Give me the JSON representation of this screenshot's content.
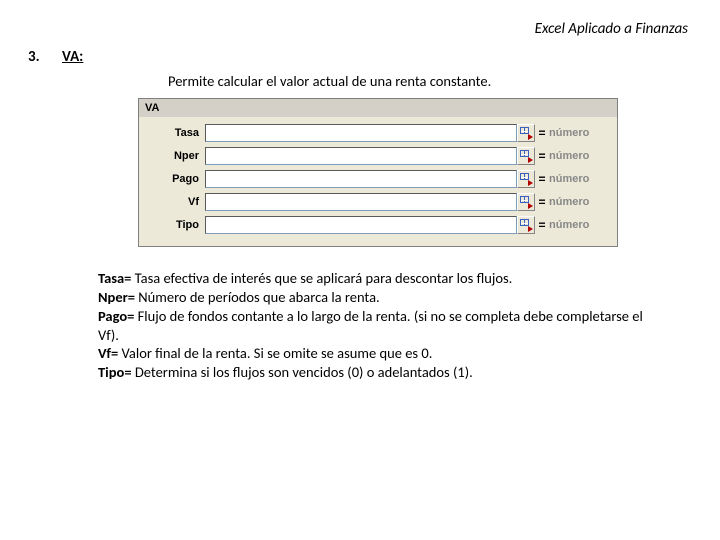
{
  "header": {
    "title": "Excel Aplicado a Finanzas"
  },
  "section": {
    "number": "3.",
    "function": "VA:",
    "description": "Permite calcular el valor actual de una renta constante."
  },
  "dialog": {
    "title": "VA",
    "eq": "=",
    "hint": "número",
    "fields": [
      {
        "label": "Tasa"
      },
      {
        "label": "Nper"
      },
      {
        "label": "Pago"
      },
      {
        "label": "Vf"
      },
      {
        "label": "Tipo"
      }
    ]
  },
  "defs": [
    {
      "term": "Tasa=",
      "body": " Tasa efectiva de interés que se aplicará para descontar los flujos."
    },
    {
      "term": "Nper=",
      "body": " Número de períodos que abarca la renta."
    },
    {
      "term": "Pago=",
      "body": " Flujo de fondos contante a lo largo de la renta. (si no se completa debe completarse el Vf)."
    },
    {
      "term": "Vf=",
      "body": " Valor final de la renta. Si se omite se asume que es 0."
    },
    {
      "term": "Tipo=",
      "body": " Determina si los flujos son vencidos (0) o adelantados (1)."
    }
  ]
}
